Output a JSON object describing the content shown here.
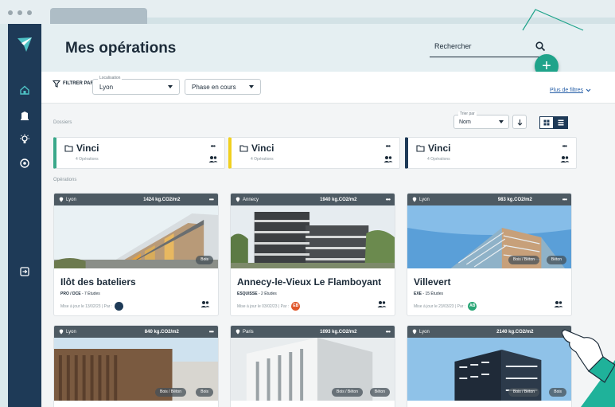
{
  "header": {
    "title": "Mes opérations",
    "search_placeholder": "Rechercher",
    "add_label": "+"
  },
  "filters": {
    "label": "FILTRER PAR :",
    "location_label": "Localisation",
    "location_value": "Lyon",
    "phase_value": "Phase en cours",
    "more_label": "Plus de filtres"
  },
  "folders_section": {
    "label": "Dossiers",
    "sort_label": "Trier par",
    "sort_value": "Nom",
    "items": [
      {
        "name": "Vinci",
        "count": "4 Opérations",
        "color": "#3aa88a"
      },
      {
        "name": "Vinci",
        "count": "4 Opérations",
        "color": "#f0d020"
      },
      {
        "name": "Vinci",
        "count": "4 Opérations",
        "color": "#1e3a57"
      }
    ]
  },
  "operations_section": {
    "label": "Opérations",
    "cards": [
      {
        "location": "Lyon",
        "co2": "1424 kg.CO2/m2",
        "tags": [
          "Bois"
        ],
        "title": "Ilôt des bateliers",
        "phase": "PRO / DCE",
        "studies": " - 7 Études",
        "updated": "Mise à jour le 13/02/23 | Par :",
        "avatar": "",
        "avatar_color": "#1e3a57"
      },
      {
        "location": "Annecy",
        "co2": "1940 kg.CO2/m2",
        "tags": [],
        "title": "Annecy-le-Vieux Le Flamboyant",
        "phase": "ESQUISSE",
        "studies": " - 2 Études",
        "updated": "Mise à jour le 03/02/23 | Par :",
        "avatar": "EB",
        "avatar_color": "#e0562a"
      },
      {
        "location": "Lyon",
        "co2": "983 kg.CO2/m2",
        "tags": [
          "Bois / Béton",
          "Béton"
        ],
        "title": "Villevert",
        "phase": "EXE",
        "studies": " - 15 Études",
        "updated": "Mise à jour le 23/03/23 | Par :",
        "avatar": "AB",
        "avatar_color": "#2aa676"
      },
      {
        "location": "Lyon",
        "co2": "840 kg.CO2/m2",
        "tags": [
          "Bois / Béton",
          "Bois"
        ],
        "title": "",
        "phase": "",
        "studies": "",
        "updated": "",
        "avatar": "",
        "avatar_color": "#1e3a57"
      },
      {
        "location": "Paris",
        "co2": "1093 kg.CO2/m2",
        "tags": [
          "Bois / Béton",
          "Béton"
        ],
        "title": "",
        "phase": "",
        "studies": "",
        "updated": "",
        "avatar": "",
        "avatar_color": "#1e3a57"
      },
      {
        "location": "Lyon",
        "co2": "2140 kg.CO2/m2",
        "tags": [
          "Bois / Béton",
          "Bois"
        ],
        "title": "",
        "phase": "",
        "studies": "",
        "updated": "",
        "avatar": "",
        "avatar_color": "#1e3a57"
      }
    ]
  },
  "icons": {
    "sidebar": [
      "logo-icon",
      "home-icon",
      "building-icon",
      "bulb-icon",
      "settings-icon",
      "logout-icon"
    ],
    "misc": [
      "search-icon",
      "filter-icon",
      "folder-icon",
      "location-pin-icon",
      "members-icon",
      "more-icon"
    ]
  },
  "colors": {
    "sidebar": "#1e3a57",
    "accent": "#1fa38a",
    "card_head": "#4d5a63"
  }
}
